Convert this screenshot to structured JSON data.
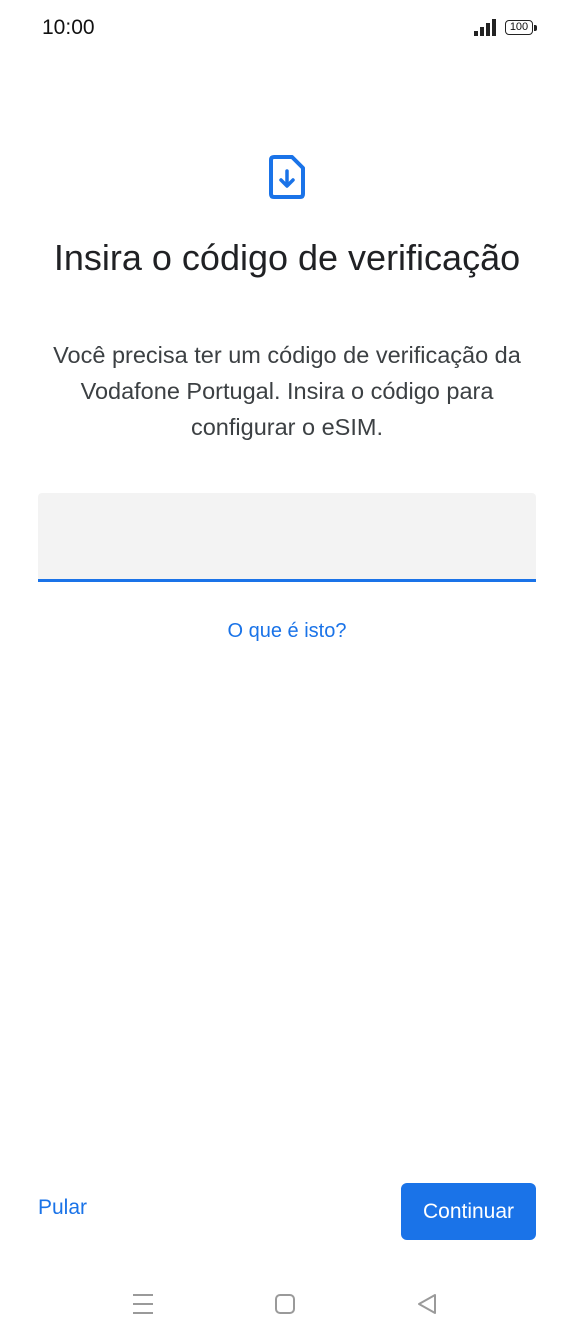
{
  "status_bar": {
    "time": "10:00",
    "battery": "100",
    "signal_icon": "signal-bars-icon",
    "battery_icon": "battery-icon"
  },
  "header": {
    "icon": "sim-download-icon",
    "title": "Insira o código de verificação",
    "description": "Você precisa ter um código de verificação da Vodafone Portugal. Insira o código para configurar o eSIM."
  },
  "form": {
    "code_value": "",
    "code_placeholder": "",
    "help_link": "O que é isto?"
  },
  "actions": {
    "skip_label": "Pular",
    "continue_label": "Continuar"
  },
  "nav_bar": {
    "menu_icon": "menu-lines-icon",
    "home_icon": "home-square-icon",
    "back_icon": "back-triangle-icon"
  },
  "colors": {
    "accent": "#1a73e8",
    "field_background": "#f3f3f3",
    "text_primary": "#202124",
    "text_secondary": "#3c4043"
  }
}
